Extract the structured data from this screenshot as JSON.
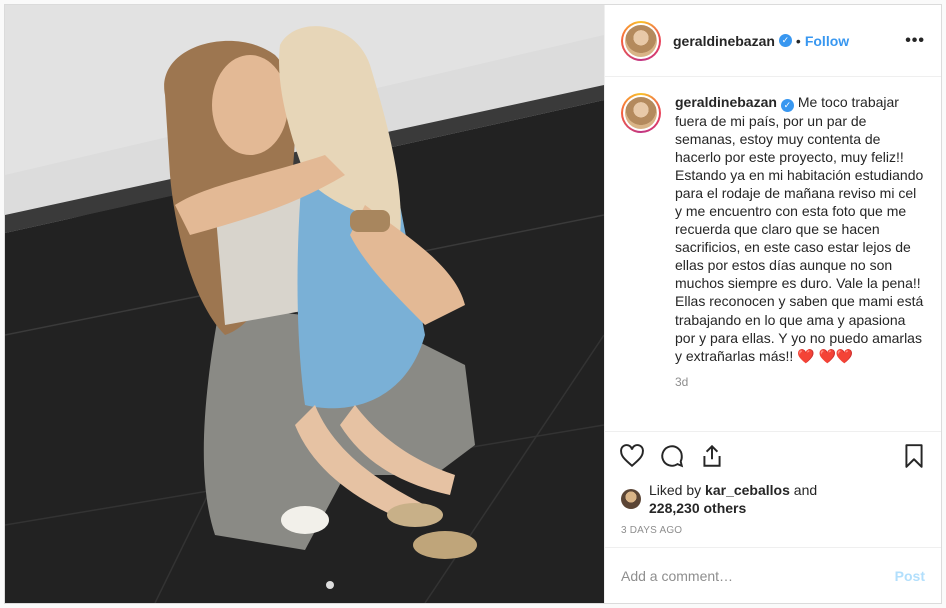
{
  "post": {
    "author": {
      "username": "geraldinebazan",
      "verified_icon": "verified-badge-icon",
      "follow_label": "Follow",
      "more_label": "•••"
    },
    "caption": {
      "text": "Me toco trabajar fuera de mi país, por un par de semanas, estoy muy contenta de hacerlo por este proyecto, muy feliz!! Estando ya en mi habitación estudiando para el rodaje de mañana reviso mi cel y me encuentro con esta foto que me recuerda que claro que se hacen sacrificios, en este caso estar lejos de ellas por estos días aunque no son muchos siempre es duro. Vale la pena!! Ellas reconocen y saben que mami está trabajando en lo que ama y apasiona por y para ellas. Y yo no puedo amarlas y extrañarlas más!! ❤️ ❤️❤️",
      "age": "3d"
    },
    "likes": {
      "prefix": "Liked by ",
      "liker": "kar_ceballos",
      "conjunction": " and",
      "count_text": "228,230 others"
    },
    "timestamp": "3 DAYS AGO",
    "comment_box": {
      "placeholder": "Add a comment…",
      "post_label": "Post"
    },
    "colors": {
      "link_blue": "#3897f0",
      "post_disabled": "#b2dffc",
      "muted": "#8e8e8e"
    }
  }
}
